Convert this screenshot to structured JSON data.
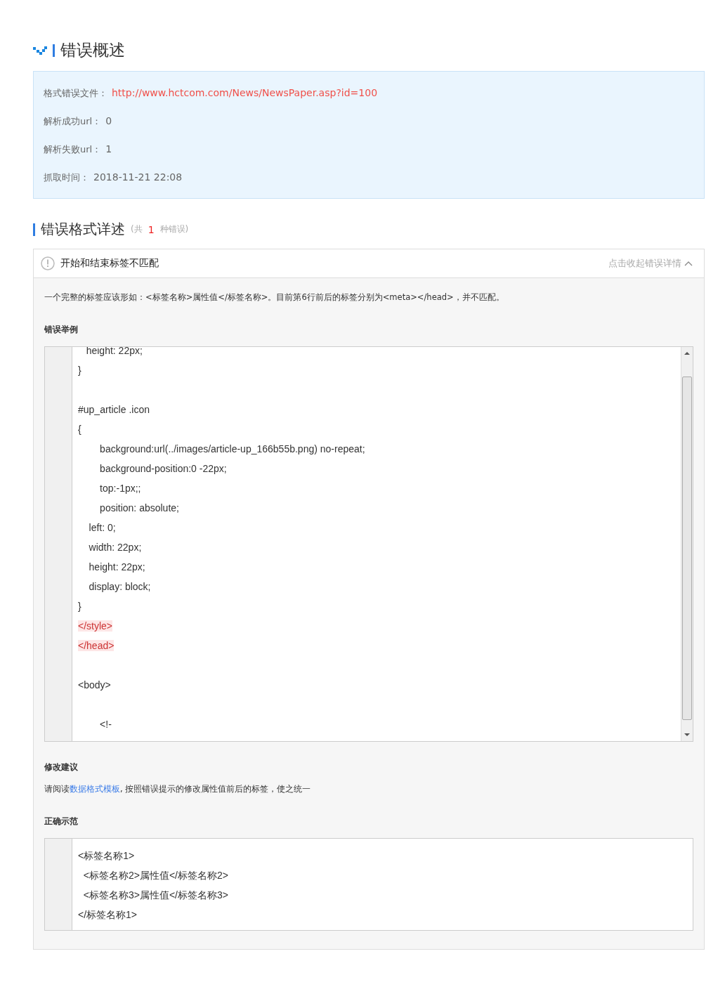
{
  "overview": {
    "title": "错误概述",
    "fields": [
      {
        "label": "格式错误文件：",
        "value": "http://www.hctcom.com/News/NewsPaper.asp?id=100",
        "kind": "link"
      },
      {
        "label": "解析成功url：",
        "value": "0",
        "kind": "plain"
      },
      {
        "label": "解析失败url：",
        "value": "1",
        "kind": "plain"
      },
      {
        "label": "抓取时间：",
        "value": "2018-11-21 22:08",
        "kind": "plain"
      }
    ]
  },
  "details": {
    "title": "错误格式详述",
    "count_prefix": "(共",
    "count": "1",
    "count_suffix": "种错误)",
    "error": {
      "title": "开始和结束标签不匹配",
      "toggle": "点击收起错误详情",
      "expanded": true,
      "description": "一个完整的标签应该形如：<标签名称>属性值</标签名称>。目前第6行前后的标签分别为<meta></head>，并不匹配。",
      "example_heading": "错误举例",
      "example_lines": [
        {
          "kind": "code",
          "text": "   height: 22px;",
          "highlighted": false
        },
        {
          "kind": "code",
          "text": "}",
          "highlighted": false
        },
        {
          "kind": "blank"
        },
        {
          "kind": "code",
          "text": "#up_article .icon",
          "highlighted": false
        },
        {
          "kind": "code",
          "text": "{",
          "highlighted": false
        },
        {
          "kind": "code",
          "text": "        background:url(../images/article-up_166b55b.png) no-repeat;",
          "highlighted": false
        },
        {
          "kind": "code",
          "text": "        background-position:0 -22px;",
          "highlighted": false
        },
        {
          "kind": "code",
          "text": "        top:-1px;;",
          "highlighted": false
        },
        {
          "kind": "code",
          "text": "        position: absolute;",
          "highlighted": false
        },
        {
          "kind": "code",
          "text": "    left: 0;",
          "highlighted": false
        },
        {
          "kind": "code",
          "text": "    width: 22px;",
          "highlighted": false
        },
        {
          "kind": "code",
          "text": "    height: 22px;",
          "highlighted": false
        },
        {
          "kind": "code",
          "text": "    display: block;",
          "highlighted": false
        },
        {
          "kind": "code",
          "text": "}",
          "highlighted": false
        },
        {
          "kind": "code",
          "text": "</style>",
          "highlighted": true
        },
        {
          "kind": "code",
          "text": "</head>",
          "highlighted": true
        },
        {
          "kind": "blank"
        },
        {
          "kind": "code",
          "text": "<body>",
          "highlighted": false
        },
        {
          "kind": "blank"
        },
        {
          "kind": "code",
          "text": "        <!-",
          "highlighted": false
        }
      ],
      "suggestion_heading": "修改建议",
      "suggestion_before": "请阅读",
      "suggestion_link": "数据格式模板",
      "suggestion_after": ", 按照错误提示的修改属性值前后的标签，使之统一",
      "correct_heading": "正确示范",
      "correct_lines": [
        "<标签名称1>",
        "  <标签名称2>属性值</标签名称2>",
        "  <标签名称3>属性值</标签名称3>",
        "</标签名称1>"
      ]
    }
  }
}
